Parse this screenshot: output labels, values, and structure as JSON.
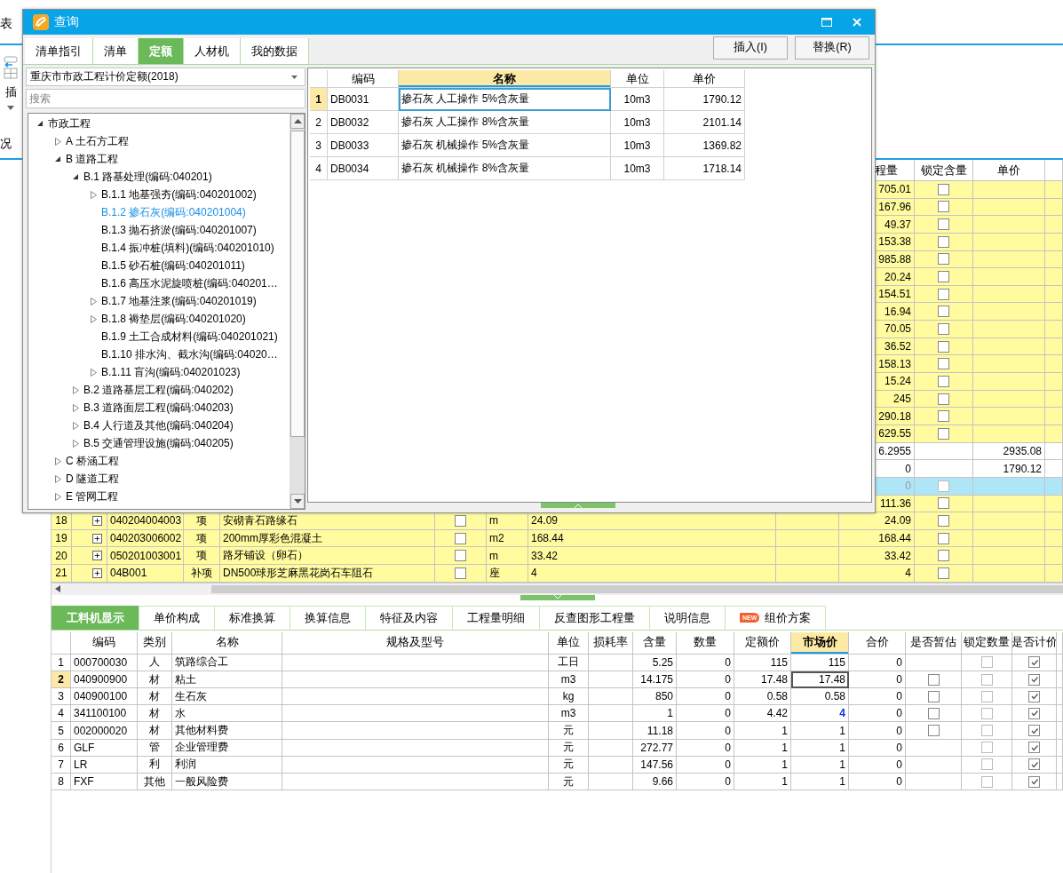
{
  "menu_bar": {
    "item": "表"
  },
  "toolbar": {
    "insert": "插"
  },
  "view_tabs": {
    "item": "况"
  },
  "grid": {
    "columns": [
      "程量",
      "锁定含量",
      "单价"
    ],
    "rows": [
      {
        "kind": "item",
        "quantity": "705.01",
        "locked": false
      },
      {
        "kind": "item",
        "quantity": "167.96",
        "locked": false
      },
      {
        "kind": "item",
        "quantity": "49.37",
        "locked": false
      },
      {
        "kind": "item",
        "quantity": "153.38",
        "locked": false
      },
      {
        "kind": "item",
        "quantity": "985.88",
        "locked": false
      },
      {
        "kind": "item",
        "quantity": "20.24",
        "locked": false
      },
      {
        "kind": "item",
        "quantity": "154.51",
        "locked": false
      },
      {
        "kind": "item",
        "quantity": "16.94",
        "locked": false
      },
      {
        "kind": "item",
        "quantity": "70.05",
        "locked": false
      },
      {
        "kind": "item",
        "quantity": "36.52",
        "locked": false
      },
      {
        "kind": "item",
        "quantity": "158.13",
        "locked": false
      },
      {
        "kind": "item",
        "quantity": "15.24",
        "locked": false
      },
      {
        "kind": "item",
        "quantity": "245",
        "locked": false
      },
      {
        "kind": "item",
        "quantity": "290.18",
        "locked": false
      },
      {
        "kind": "item",
        "quantity": "629.55",
        "locked": false
      },
      {
        "kind": "quota",
        "quantity": "6.2955",
        "unit_price": "2935.08"
      },
      {
        "kind": "quota",
        "quantity": "0",
        "unit_price": "1790.12"
      },
      {
        "kind": "new",
        "quantity": "0",
        "locked": false
      },
      {
        "kind": "item",
        "quantity": "111.36",
        "locked": false
      },
      {
        "kind": "item",
        "number": "18",
        "expanded": false,
        "code": "040204004003",
        "type": "项",
        "name": "安砌青石路缘石",
        "checked": false,
        "unit": "m",
        "expression": "24.09",
        "quantity": "24.09",
        "locked": false
      },
      {
        "kind": "item",
        "number": "19",
        "expanded": false,
        "code": "040203006002",
        "type": "项",
        "name": "200mm厚彩色混凝土",
        "checked": false,
        "unit": "m2",
        "expression": "168.44",
        "quantity": "168.44",
        "locked": false
      },
      {
        "kind": "item",
        "number": "20",
        "expanded": false,
        "code": "050201003001",
        "type": "项",
        "name": "路牙铺设（卵石）",
        "checked": false,
        "unit": "m",
        "expression": "33.42",
        "quantity": "33.42",
        "locked": false
      },
      {
        "kind": "item",
        "number": "21",
        "expanded": false,
        "code": "04B001",
        "type": "补项",
        "name": "DN500球形芝麻黑花岗石车阻石",
        "checked": false,
        "unit": "座",
        "expression": "4",
        "quantity": "4",
        "locked": false
      }
    ]
  },
  "bottom_tabs": [
    {
      "label": "工料机显示",
      "selected": true
    },
    {
      "label": "单价构成",
      "selected": false
    },
    {
      "label": "标准换算",
      "selected": false
    },
    {
      "label": "换算信息",
      "selected": false
    },
    {
      "label": "特征及内容",
      "selected": false
    },
    {
      "label": "工程量明细",
      "selected": false
    },
    {
      "label": "反查图形工程量",
      "selected": false
    },
    {
      "label": "说明信息",
      "selected": false
    },
    {
      "label": "组价方案",
      "selected": false,
      "badge": "NEW"
    }
  ],
  "resources": {
    "columns": [
      {
        "label": "编码",
        "current": false
      },
      {
        "label": "类别",
        "current": false
      },
      {
        "label": "名称",
        "current": false
      },
      {
        "label": "规格及型号",
        "current": false
      },
      {
        "label": "单位",
        "current": false
      },
      {
        "label": "损耗率",
        "current": false
      },
      {
        "label": "含量",
        "current": false
      },
      {
        "label": "数量",
        "current": false
      },
      {
        "label": "定额价",
        "current": false
      },
      {
        "label": "市场价",
        "current": true
      },
      {
        "label": "合价",
        "current": false
      },
      {
        "label": "是否暂估",
        "current": false
      },
      {
        "label": "锁定数量",
        "current": false
      },
      {
        "label": "是否计价",
        "current": false
      }
    ],
    "rows": [
      {
        "number": "1",
        "code": "000700030",
        "category": "人",
        "name": "筑路综合工",
        "unit": "工日",
        "content": "5.25",
        "quantity": "0",
        "quota_price": "115",
        "market_price": "115",
        "price_changed": false,
        "total": "0",
        "lock_quantity": false,
        "priced": true,
        "selected": false
      },
      {
        "number": "2",
        "code": "040900900",
        "category": "材",
        "name": "粘土",
        "unit": "m3",
        "content": "14.175",
        "quantity": "0",
        "quota_price": "17.48",
        "market_price": "17.48",
        "price_changed": false,
        "total": "0",
        "provisional": {
          "checked": false
        },
        "lock_quantity": false,
        "priced": true,
        "selected": true
      },
      {
        "number": "3",
        "code": "040900100",
        "category": "材",
        "name": "生石灰",
        "unit": "kg",
        "content": "850",
        "quantity": "0",
        "quota_price": "0.58",
        "market_price": "0.58",
        "price_changed": false,
        "total": "0",
        "provisional": {
          "checked": false
        },
        "lock_quantity": false,
        "priced": true,
        "selected": false
      },
      {
        "number": "4",
        "code": "341100100",
        "category": "材",
        "name": "水",
        "unit": "m3",
        "content": "1",
        "quantity": "0",
        "quota_price": "4.42",
        "market_price": "4",
        "price_changed": true,
        "total": "0",
        "provisional": {
          "checked": false
        },
        "lock_quantity": false,
        "priced": true,
        "selected": false
      },
      {
        "number": "5",
        "code": "002000020",
        "category": "材",
        "name": "其他材料费",
        "unit": "元",
        "content": "11.18",
        "quantity": "0",
        "quota_price": "1",
        "market_price": "1",
        "price_changed": false,
        "total": "0",
        "provisional": {
          "checked": false
        },
        "lock_quantity": false,
        "priced": true,
        "selected": false
      },
      {
        "number": "6",
        "code": "GLF",
        "category": "管",
        "name": "企业管理费",
        "unit": "元",
        "content": "272.77",
        "quantity": "0",
        "quota_price": "1",
        "market_price": "1",
        "price_changed": false,
        "total": "0",
        "lock_quantity": false,
        "priced": true,
        "selected": false
      },
      {
        "number": "7",
        "code": "LR",
        "category": "利",
        "name": "利润",
        "unit": "元",
        "content": "147.56",
        "quantity": "0",
        "quota_price": "1",
        "market_price": "1",
        "price_changed": false,
        "total": "0",
        "lock_quantity": false,
        "priced": true,
        "selected": false
      },
      {
        "number": "8",
        "code": "FXF",
        "category": "其他",
        "name": "一般风险费",
        "unit": "元",
        "content": "9.66",
        "quantity": "0",
        "quota_price": "1",
        "market_price": "1",
        "price_changed": false,
        "total": "0",
        "lock_quantity": false,
        "priced": true,
        "selected": false
      }
    ]
  },
  "dialog": {
    "title": "查询",
    "tabs": [
      {
        "label": "清单指引",
        "selected": false
      },
      {
        "label": "清单",
        "selected": false
      },
      {
        "label": "定额",
        "selected": true
      },
      {
        "label": "人材机",
        "selected": false
      },
      {
        "label": "我的数据",
        "selected": false
      }
    ],
    "buttons": [
      "插入(I)",
      "替换(R)"
    ],
    "library": "重庆市市政工程计价定额(2018)",
    "search": {
      "placeholder": "搜索"
    },
    "tree": [
      {
        "label": "市政工程",
        "kind": "folder",
        "expanded": true,
        "selected": false,
        "children": [
          {
            "label": "A 土石方工程",
            "kind": "folder",
            "expanded": false,
            "selected": false
          },
          {
            "label": "B 道路工程",
            "kind": "folder",
            "expanded": true,
            "selected": false,
            "children": [
              {
                "label": "B.1 路基处理(编码:040201)",
                "kind": "folder",
                "expanded": true,
                "selected": false,
                "children": [
                  {
                    "label": "B.1.1 地基强夯(编码:040201002)",
                    "kind": "folder",
                    "expanded": false,
                    "selected": false
                  },
                  {
                    "label": "B.1.2 掺石灰(编码:040201004)",
                    "kind": "leaf",
                    "selected": true
                  },
                  {
                    "label": "B.1.3 抛石挤淤(编码:040201007)",
                    "kind": "leaf",
                    "selected": false
                  },
                  {
                    "label": "B.1.4 振冲桩(填料)(编码:040201010)",
                    "kind": "leaf",
                    "selected": false
                  },
                  {
                    "label": "B.1.5 砂石桩(编码:040201011)",
                    "kind": "leaf",
                    "selected": false
                  },
                  {
                    "label": "B.1.6 高压水泥旋喷桩(编码:040201…",
                    "kind": "leaf",
                    "selected": false
                  },
                  {
                    "label": "B.1.7 地基注浆(编码:040201019)",
                    "kind": "folder",
                    "expanded": false,
                    "selected": false
                  },
                  {
                    "label": "B.1.8 褥垫层(编码:040201020)",
                    "kind": "folder",
                    "expanded": false,
                    "selected": false
                  },
                  {
                    "label": "B.1.9 土工合成材料(编码:040201021)",
                    "kind": "leaf",
                    "selected": false
                  },
                  {
                    "label": "B.1.10 排水沟、截水沟(编码:04020…",
                    "kind": "leaf",
                    "selected": false
                  },
                  {
                    "label": "B.1.11 盲沟(编码:040201023)",
                    "kind": "folder",
                    "expanded": false,
                    "selected": false
                  }
                ]
              },
              {
                "label": "B.2 道路基层工程(编码:040202)",
                "kind": "folder",
                "expanded": false,
                "selected": false
              },
              {
                "label": "B.3 道路面层工程(编码:040203)",
                "kind": "folder",
                "expanded": false,
                "selected": false
              },
              {
                "label": "B.4 人行道及其他(编码:040204)",
                "kind": "folder",
                "expanded": false,
                "selected": false
              },
              {
                "label": "B.5 交通管理设施(编码:040205)",
                "kind": "folder",
                "expanded": false,
                "selected": false
              }
            ]
          },
          {
            "label": "C 桥涵工程",
            "kind": "folder",
            "expanded": false,
            "selected": false
          },
          {
            "label": "D 隧道工程",
            "kind": "folder",
            "expanded": false,
            "selected": false
          },
          {
            "label": "E 管网工程",
            "kind": "folder",
            "expanded": false,
            "selected": false
          }
        ]
      }
    ],
    "table": {
      "columns": [
        {
          "label": "编码",
          "current": false
        },
        {
          "label": "名称",
          "current": true
        },
        {
          "label": "单位",
          "current": false
        },
        {
          "label": "单价",
          "current": false
        }
      ],
      "rows": [
        {
          "number": "1",
          "code": "DB0031",
          "name": "掺石灰 人工操作 5%含灰量",
          "unit": "10m3",
          "price": "1790.12",
          "selected": true
        },
        {
          "number": "2",
          "code": "DB0032",
          "name": "掺石灰 人工操作 8%含灰量",
          "unit": "10m3",
          "price": "2101.14",
          "selected": false
        },
        {
          "number": "3",
          "code": "DB0033",
          "name": "掺石灰 机械操作 5%含灰量",
          "unit": "10m3",
          "price": "1369.82",
          "selected": false
        },
        {
          "number": "4",
          "code": "DB0034",
          "name": "掺石灰 机械操作 8%含灰量",
          "unit": "10m3",
          "price": "1718.14",
          "selected": false
        }
      ]
    }
  }
}
